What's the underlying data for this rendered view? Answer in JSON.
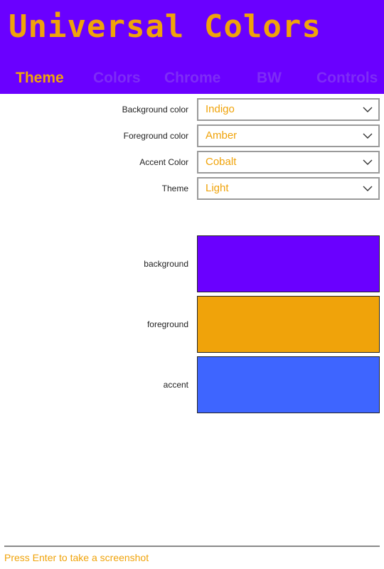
{
  "app": {
    "title": "Universal Colors"
  },
  "tabs": [
    {
      "label": "Theme",
      "active": true
    },
    {
      "label": "Colors",
      "active": false
    },
    {
      "label": "Chrome",
      "active": false
    },
    {
      "label": "BW",
      "active": false
    },
    {
      "label": "Controls",
      "active": false
    }
  ],
  "settings": [
    {
      "label": "Background color",
      "value": "Indigo"
    },
    {
      "label": "Foreground color",
      "value": "Amber"
    },
    {
      "label": "Accent Color",
      "value": "Cobalt"
    },
    {
      "label": "Theme",
      "value": "Light"
    }
  ],
  "swatches": [
    {
      "label": "background",
      "color": "#6a00ff"
    },
    {
      "label": "foreground",
      "color": "#f0a30a"
    },
    {
      "label": "accent",
      "color": "#3e65ff"
    }
  ],
  "icons": {
    "dropdown": "chevron-down-icon"
  },
  "colors": {
    "header_bg": "#6a00ff",
    "accent_text": "#f0a30a",
    "inactive_tab": "#7e2cf6"
  },
  "footer": {
    "hint": "Press Enter to take a screenshot"
  }
}
